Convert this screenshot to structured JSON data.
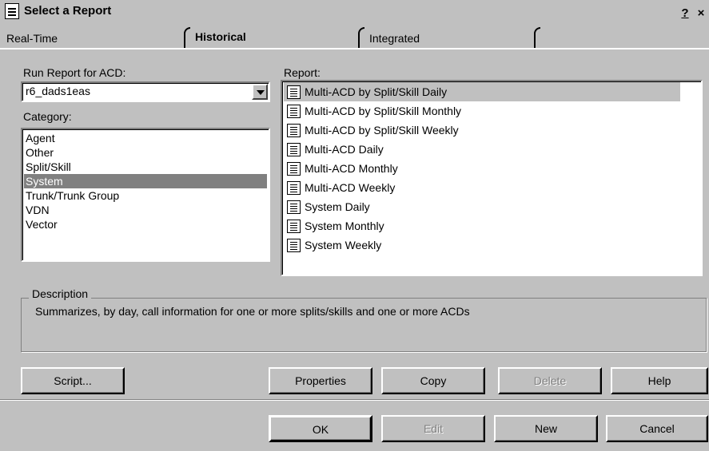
{
  "window": {
    "title": "Select a Report",
    "help_label": "?",
    "close_label": "×"
  },
  "tabs": [
    {
      "label": "Real-Time"
    },
    {
      "label": "Historical"
    },
    {
      "label": "Integrated"
    }
  ],
  "acd": {
    "label": "Run Report for ACD:",
    "value": "r6_dads1eas"
  },
  "category": {
    "label": "Category:",
    "items": [
      "Agent",
      "Other",
      "Split/Skill",
      "System",
      "Trunk/Trunk Group",
      "VDN",
      "Vector"
    ],
    "selected": "System"
  },
  "report": {
    "label": "Report:",
    "items": [
      "Multi-ACD by Split/Skill Daily",
      "Multi-ACD by Split/Skill Monthly",
      "Multi-ACD by Split/Skill Weekly",
      "Multi-ACD Daily",
      "Multi-ACD Monthly",
      "Multi-ACD Weekly",
      "System Daily",
      "System Monthly",
      "System Weekly"
    ],
    "selected": "Multi-ACD by Split/Skill Daily"
  },
  "description": {
    "label": "Description",
    "text": "Summarizes, by day, call information for one or more splits/skills and one or more ACDs"
  },
  "buttons_row1": {
    "script": "Script...",
    "properties": "Properties",
    "copy": "Copy",
    "delete": "Delete",
    "help": "Help"
  },
  "buttons_row2": {
    "ok": "OK",
    "edit": "Edit",
    "new": "New",
    "cancel": "Cancel"
  }
}
